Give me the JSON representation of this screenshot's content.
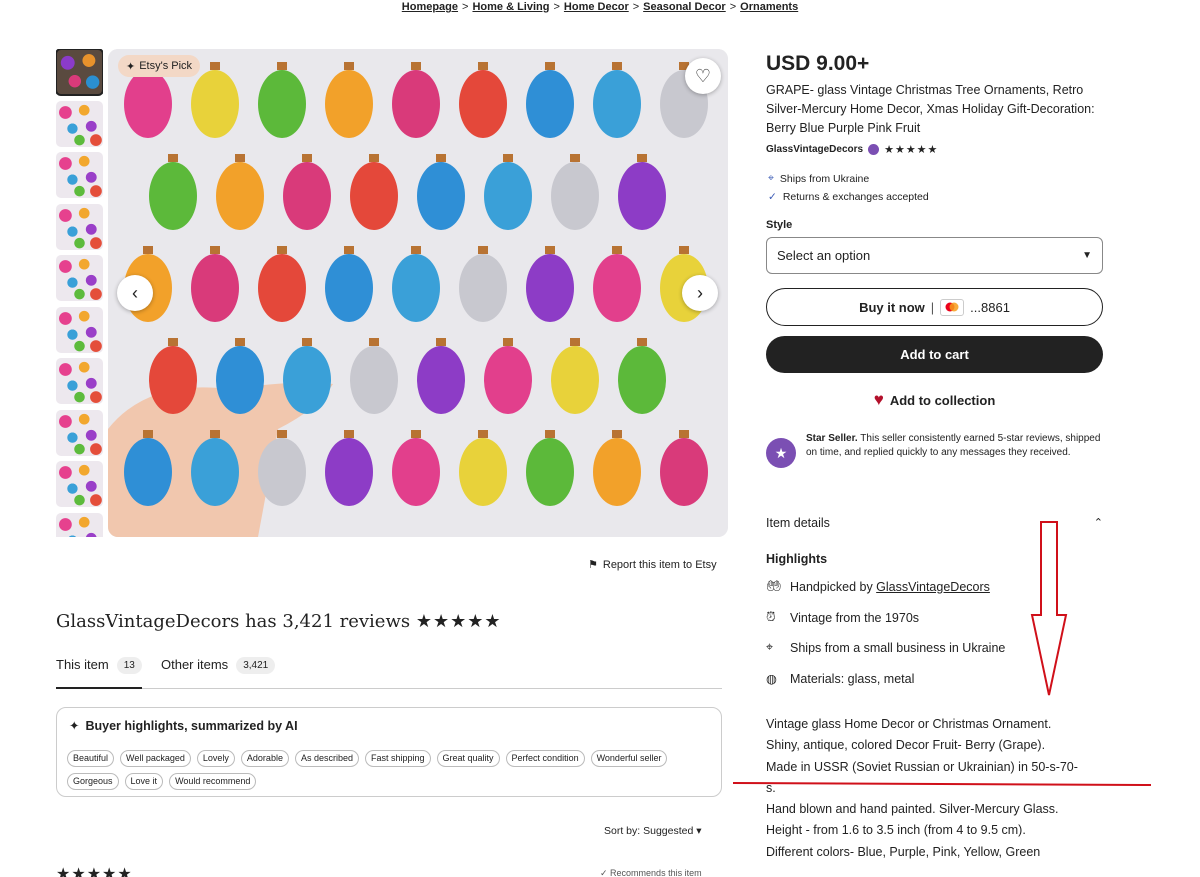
{
  "breadcrumb": [
    "Homepage",
    "Home & Living",
    "Home Decor",
    "Seasonal Decor",
    "Ornaments"
  ],
  "breadcrumb_sep": ">",
  "gallery": {
    "badge": "Etsy's Pick",
    "thumb_count": 10,
    "prev_icon": "chevron-left-icon",
    "next_icon": "chevron-right-icon",
    "fav_icon": "heart-icon"
  },
  "report": "Report this item to Etsy",
  "reviews": {
    "title": "GlassVintageDecors has 3,421 reviews",
    "stars": "★★★★★",
    "tabs": [
      {
        "label": "This item",
        "count": "13"
      },
      {
        "label": "Other items",
        "count": "3,421"
      }
    ],
    "ai_title": "Buyer highlights, summarized by AI",
    "chips": [
      "Beautiful",
      "Well packaged",
      "Lovely",
      "Adorable",
      "As described",
      "Fast shipping",
      "Great quality",
      "Perfect condition",
      "Wonderful seller",
      "Gorgeous",
      "Love it",
      "Would recommend"
    ],
    "sort": "Sort by: Suggested",
    "recommends": "Recommends this item"
  },
  "product": {
    "price": "USD 9.00+",
    "title": "GRAPE- glass Vintage Christmas Tree Ornaments, Retro Silver-Mercury Home Decor, Xmas Holiday Gift-Decoration: Berry Blue Purple Pink Fruit",
    "shop": "GlassVintageDecors",
    "shop_stars": "★★★★★",
    "ships_from": "Ships from Ukraine",
    "returns": "Returns & exchanges accepted",
    "style_label": "Style",
    "select_placeholder": "Select an option",
    "buy_now": "Buy it now",
    "card_digits": "...8861",
    "add_to_cart": "Add to cart",
    "add_collection": "Add to collection",
    "star_seller_bold": "Star Seller.",
    "star_seller_text": " This seller consistently earned 5-star reviews, shipped on time, and replied quickly to any messages they received.",
    "item_details": "Item details",
    "highlights_label": "Highlights",
    "highlights": [
      {
        "icon": "hand-icon",
        "prefix": "Handpicked by ",
        "bold": "GlassVintageDecors"
      },
      {
        "icon": "clock-icon",
        "prefix": "Vintage from the 1970s",
        "bold": ""
      },
      {
        "icon": "location-pin-icon",
        "prefix": "Ships from a small business in Ukraine",
        "bold": ""
      },
      {
        "icon": "materials-icon",
        "prefix": "Materials: glass, metal",
        "bold": ""
      }
    ],
    "description": [
      "Vintage glass Home Decor or Christmas Ornament.",
      "Shiny, antique, colored Decor Fruit- Berry (Grape).",
      "Made in USSR (Soviet Russian or Ukrainian) in 50-s-70-",
      "s.",
      "Hand blown and hand painted. Silver-Mercury Glass.",
      "Height - from 1.6 to 3.5 inch (from 4 to 9.5 cm).",
      "Different colors- Blue, Purple, Pink, Yellow, Green"
    ]
  },
  "colors": {
    "dark": "#222222",
    "annotation_red": "#d0101a",
    "badge_bg": "#f3d8c6",
    "star_seller": "#7b4fb3",
    "heart": "#b3102b"
  }
}
